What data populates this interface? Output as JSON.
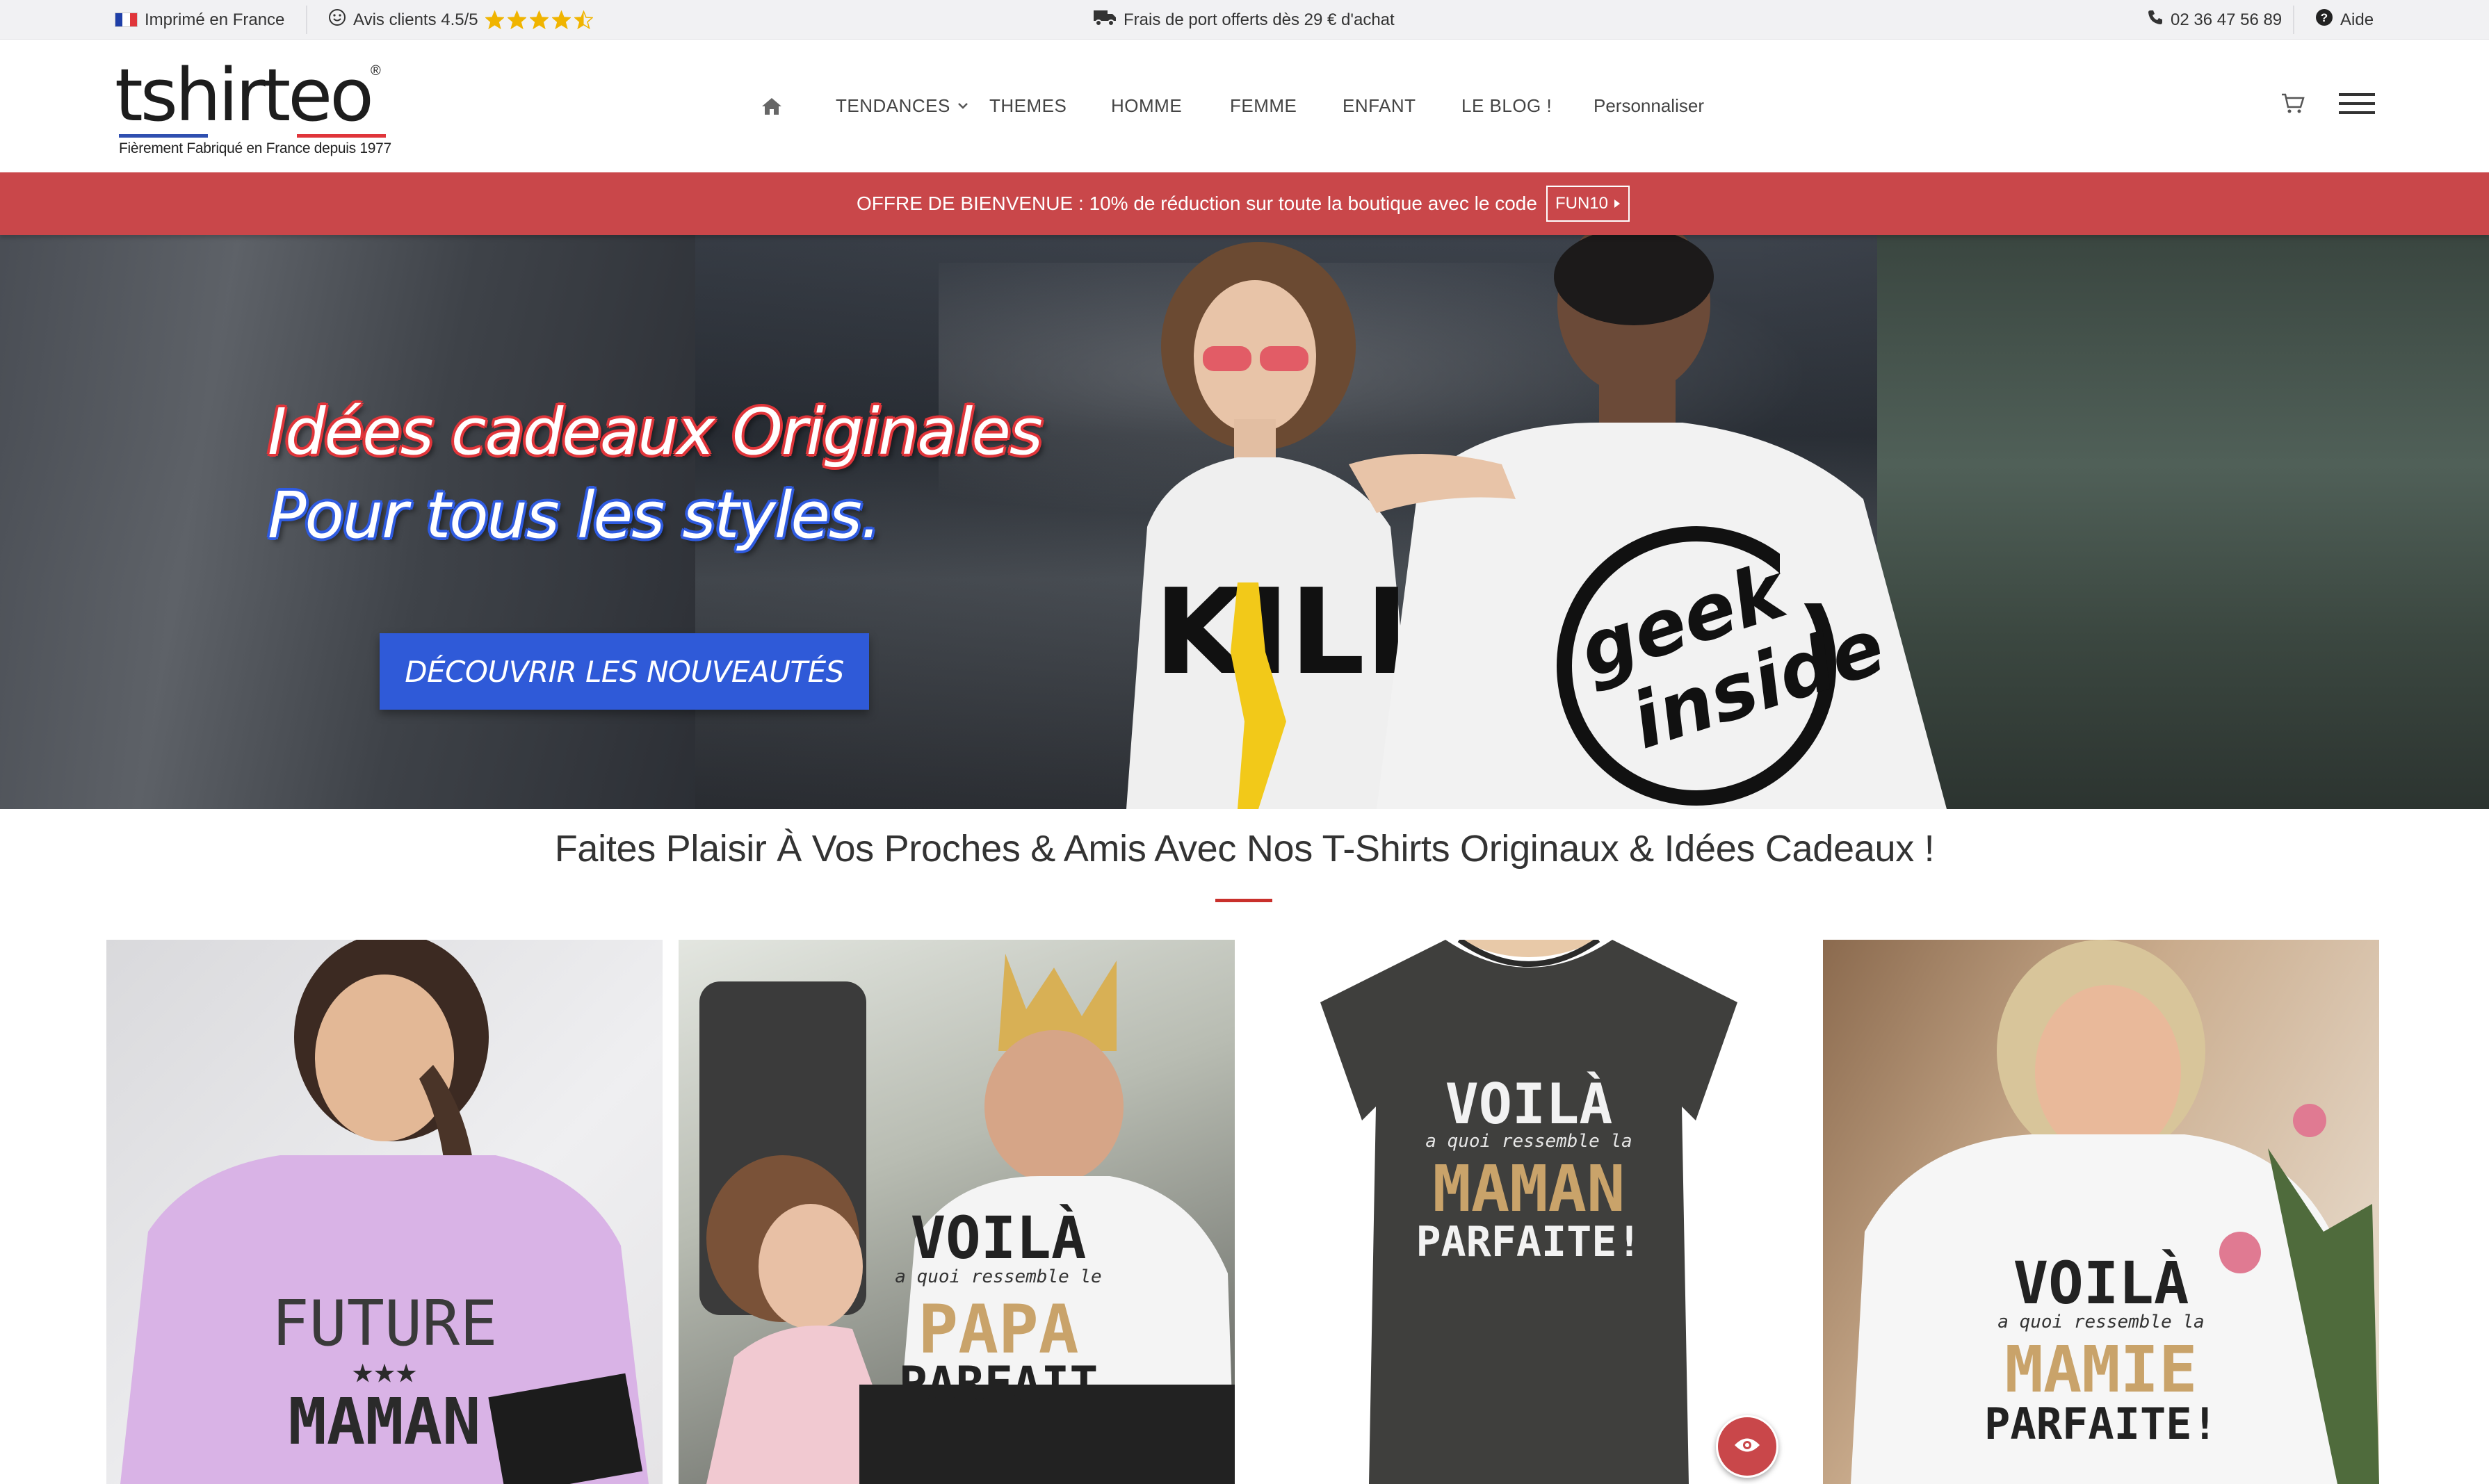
{
  "topbar": {
    "printed": "Imprimé en France",
    "reviews": "Avis clients 4.5/5",
    "rating": 4.5,
    "rating_max": 5,
    "shipping": "Frais de port offerts dès 29 € d'achat",
    "phone": "02 36 47 56 89",
    "help": "Aide"
  },
  "header": {
    "logo_word": "tshirteo",
    "logo_tagline": "Fièrement Fabriqué en France depuis 1977",
    "nav": {
      "trends": "TENDANCES",
      "themes": "THEMES",
      "men": "HOMME",
      "women": "FEMME",
      "kids": "ENFANT",
      "blog": "LE BLOG !",
      "customize": "Personnaliser"
    }
  },
  "promo": {
    "text": "OFFRE DE BIENVENUE : 10% de réduction sur toute la boutique avec le code",
    "code": "FUN10"
  },
  "hero": {
    "title_line1": "Idées cadeaux Originales",
    "title_line2": "Pour tous les styles.",
    "cta": "DÉCOUVRIR LES NOUVEAUTÉS",
    "shirt_left_text": "KILL",
    "shirt_right_text1": "geek",
    "shirt_right_text2": "inside"
  },
  "section": {
    "title": "Faites Plaisir À Vos Proches & Amis Avec Nos T-Shirts Originaux & Idées Cadeaux !"
  },
  "products": [
    {
      "line1": "FUTURE",
      "stars": "★★★",
      "line2": "MAMAN"
    },
    {
      "line1": "VOILÀ",
      "sub": "a quoi ressemble le",
      "line2": "PAPA",
      "line3": "PARFAIT"
    },
    {
      "line1": "VOILÀ",
      "sub": "a quoi ressemble la",
      "line2": "MAMAN",
      "line3": "PARFAITE!"
    },
    {
      "line1": "VOILÀ",
      "sub": "a quoi ressemble la",
      "line2": "MAMIE",
      "line3": "PARFAITE!"
    }
  ],
  "colors": {
    "promo_bg": "#c9474a",
    "cta_bg": "#2f5ad8",
    "accent_red": "#c9302c",
    "star": "#f0b400"
  },
  "icons": {
    "flag": "france-flag-icon",
    "reviews": "smiley-icon",
    "shipping": "truck-icon",
    "phone": "phone-icon",
    "help": "question-circle-icon",
    "home": "home-icon",
    "cart": "cart-icon",
    "menu": "hamburger-menu-icon",
    "eye": "eye-icon"
  }
}
